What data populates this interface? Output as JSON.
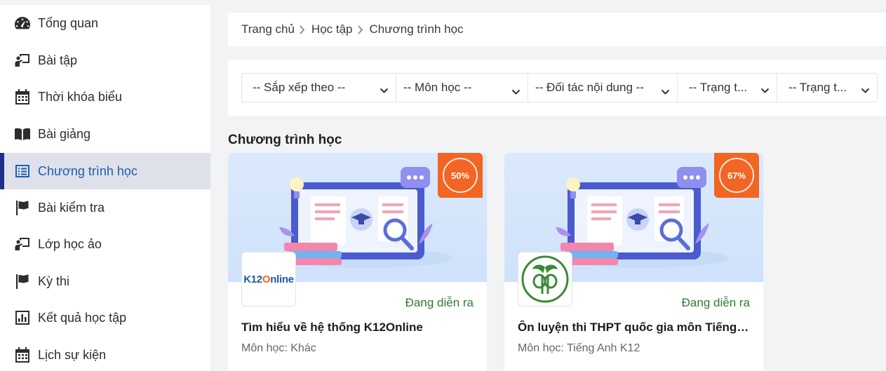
{
  "sidebar": {
    "items": [
      {
        "label": "Tổng quan",
        "icon": "dashboard-icon"
      },
      {
        "label": "Bài tập",
        "icon": "teacher-board-icon"
      },
      {
        "label": "Thời khóa biểu",
        "icon": "calendar-icon"
      },
      {
        "label": "Bài giảng",
        "icon": "book-icon"
      },
      {
        "label": "Chương trình học",
        "icon": "list-icon",
        "active": true
      },
      {
        "label": "Bài kiểm tra",
        "icon": "flag-icon"
      },
      {
        "label": "Lớp học ảo",
        "icon": "teacher-board-icon"
      },
      {
        "label": "Kỳ thi",
        "icon": "flag-icon"
      },
      {
        "label": "Kết quả học tập",
        "icon": "bar-chart-icon"
      },
      {
        "label": "Lịch sự kiện",
        "icon": "calendar-icon"
      }
    ]
  },
  "breadcrumb": [
    "Trang chủ",
    "Học tập",
    "Chương trình học"
  ],
  "filters": [
    "-- Sắp xếp theo --",
    "-- Môn học --",
    "-- Đối tác nội dung --",
    "-- Trạng t...",
    "-- Trạng t..."
  ],
  "section_title": "Chương trình học",
  "courses": [
    {
      "progress": "50%",
      "logo_text": "K12Online",
      "status": "Đang diễn ra",
      "title": "Tìm hiểu về hệ thống K12Online",
      "subject": "Môn học: Khác"
    },
    {
      "progress": "67%",
      "logo_text": "",
      "status": "Đang diễn ra",
      "title": "Ôn luyện thi THPT quốc gia môn Tiếng Anh",
      "subject": "Môn học: Tiếng Anh K12"
    }
  ],
  "colors": {
    "accent": "#1a5fb4",
    "active_bar": "#1e2f8c",
    "progress_badge": "#f26522",
    "status_green": "#2e7d32"
  }
}
